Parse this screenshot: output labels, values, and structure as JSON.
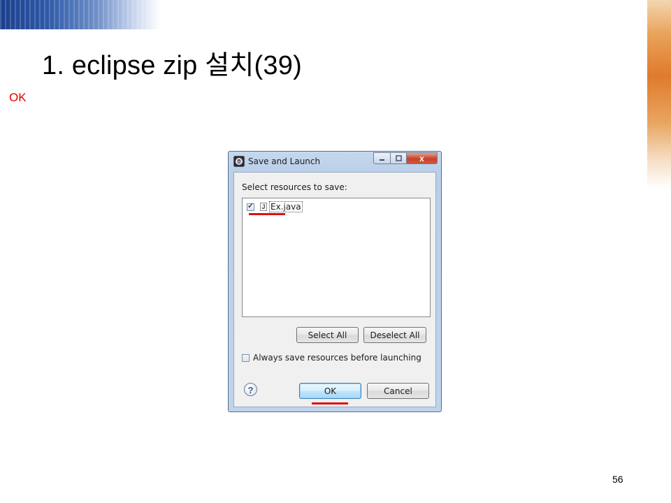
{
  "slide": {
    "title": "1. eclipse zip 설치(39)",
    "note": "OK",
    "page_number": "56"
  },
  "dialog": {
    "title": "Save and Launch",
    "app_icon": "eclipse-icon",
    "window_controls": [
      "minimize",
      "maximize",
      "close"
    ],
    "close_glyph": "x",
    "resources_label": "Select resources to save:",
    "resources": [
      {
        "name": "Ex.java",
        "checked": true,
        "icon": "java-file-icon",
        "icon_glyph": "J"
      }
    ],
    "select_all": "Select All",
    "deselect_all": "Deselect All",
    "always_save_label": "Always save resources before launching",
    "always_save_checked": false,
    "help_glyph": "?",
    "ok_label": "OK",
    "cancel_label": "Cancel"
  },
  "colors": {
    "highlight": "#e01010",
    "note_text": "#e00000"
  }
}
